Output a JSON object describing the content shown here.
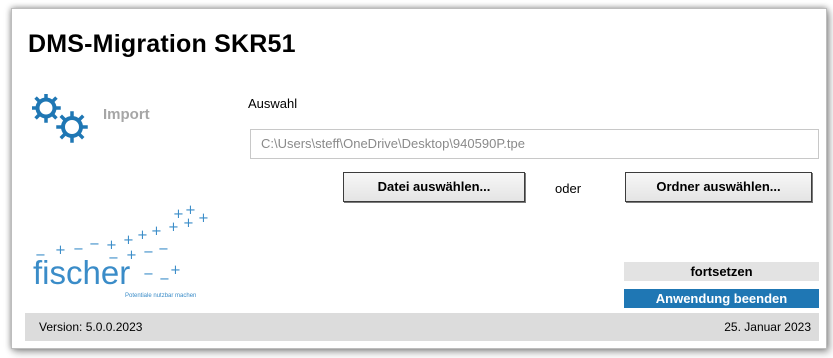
{
  "window": {
    "title": "DMS-Migration SKR51"
  },
  "sidebar": {
    "import_label": "Import",
    "icon": "gears-icon"
  },
  "selection": {
    "label": "Auswahl",
    "path_value": "C:\\Users\\steff\\OneDrive\\Desktop\\940590P.tpe",
    "select_file_label": "Datei auswählen...",
    "or_label": "oder",
    "select_folder_label": "Ordner auswählen..."
  },
  "logo": {
    "brand": "fischer",
    "tagline": "Potentiale nutzbar machen"
  },
  "actions": {
    "continue_label": "fortsetzen",
    "exit_label": "Anwendung beenden"
  },
  "footer": {
    "version": "Version: 5.0.0.2023",
    "date": "25. Januar 2023"
  },
  "colors": {
    "accent": "#1f77b4",
    "logo_blue": "#3a8cc8",
    "muted": "#a6a6a6"
  }
}
